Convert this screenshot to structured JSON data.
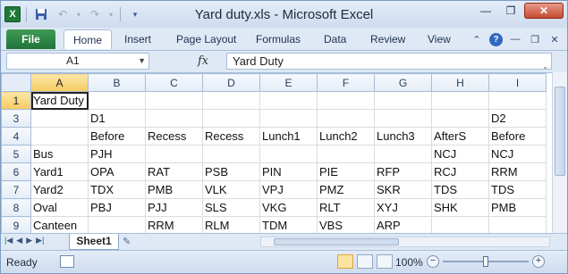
{
  "window": {
    "title": "Yard duty.xls  -  Microsoft Excel"
  },
  "qat": {
    "logo": "X",
    "save_icon": "save-icon",
    "undo_icon": "undo-icon",
    "redo_icon": "redo-icon"
  },
  "ribbon": {
    "tabs": [
      "File",
      "Home",
      "Insert",
      "Page Layout",
      "Formulas",
      "Data",
      "Review",
      "View"
    ],
    "active_tab": "Home",
    "file_color": "#2a8a44"
  },
  "formula_bar": {
    "name_box": "A1",
    "fx_label": "fx",
    "content": "Yard Duty"
  },
  "sheet": {
    "column_headers": [
      "A",
      "B",
      "C",
      "D",
      "E",
      "F",
      "G",
      "H",
      "I"
    ],
    "rows": [
      {
        "num": "1",
        "cells": [
          "Yard Duty",
          "",
          "",
          "",
          "",
          "",
          "",
          "",
          ""
        ]
      },
      {
        "num": "3",
        "cells": [
          "",
          "D1",
          "",
          "",
          "",
          "",
          "",
          "",
          "D2"
        ]
      },
      {
        "num": "4",
        "cells": [
          "",
          "Before",
          "Recess",
          "Recess",
          "Lunch1",
          "Lunch2",
          "Lunch3",
          "AfterS",
          "Before"
        ]
      },
      {
        "num": "5",
        "cells": [
          "Bus",
          "PJH",
          "",
          "",
          "",
          "",
          "",
          "NCJ",
          "NCJ"
        ]
      },
      {
        "num": "6",
        "cells": [
          "Yard1",
          "OPA",
          "RAT",
          "PSB",
          "PIN",
          "PIE",
          "RFP",
          "RCJ",
          "RRM"
        ]
      },
      {
        "num": "7",
        "cells": [
          "Yard2",
          "TDX",
          "PMB",
          "VLK",
          "VPJ",
          "PMZ",
          "SKR",
          "TDS",
          "TDS"
        ]
      },
      {
        "num": "8",
        "cells": [
          "Oval",
          "PBJ",
          "PJJ",
          "SLS",
          "VKG",
          "RLT",
          "XYJ",
          "SHK",
          "PMB"
        ]
      },
      {
        "num": "9",
        "cells": [
          "Canteen",
          "",
          "RRM",
          "RLM",
          "TDM",
          "VBS",
          "ARP",
          "",
          ""
        ]
      }
    ]
  },
  "tabs": {
    "sheet_name": "Sheet1"
  },
  "status": {
    "ready": "Ready",
    "zoom": "100%",
    "zoom_level": 0.5
  }
}
